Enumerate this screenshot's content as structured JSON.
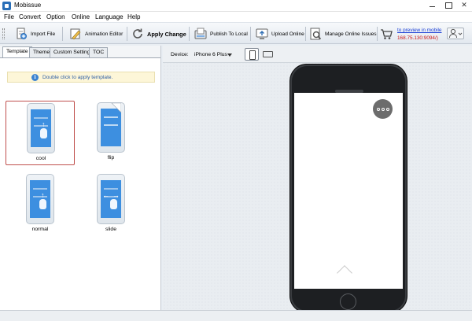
{
  "window": {
    "title": "Mobissue",
    "controls": [
      "minimize",
      "maximize",
      "close"
    ]
  },
  "menu": [
    "File",
    "Convert",
    "Option",
    "Online",
    "Language",
    "Help"
  ],
  "toolbar": {
    "import_file": "Import File",
    "animation_editor": "Animation Editor",
    "apply_change": "Apply Change",
    "publish_to_local": "Publish To Local",
    "upload_online": "Upload Online",
    "manage_online_issues": "Manage Online Issues",
    "preview_link": "to preview in mobile",
    "preview_address": "168.75.130:9094/)"
  },
  "left_panel": {
    "tabs": [
      "Template",
      "Theme",
      "Custom Settings",
      "TOC"
    ],
    "active_tab": "Template",
    "hint": "Double click to apply template.",
    "templates": [
      {
        "name": "cool",
        "selected": true
      },
      {
        "name": "flip",
        "selected": false
      },
      {
        "name": "normal",
        "selected": false
      },
      {
        "name": "slide",
        "selected": false
      }
    ]
  },
  "device": {
    "label": "Device:",
    "selected": "iPhone 6 Plus",
    "orientation": "portrait"
  },
  "colors": {
    "accent_blue": "#3d8fe0",
    "selection_border": "#c0504d",
    "link": "#1a3fd6",
    "address": "#cc1a1a"
  }
}
